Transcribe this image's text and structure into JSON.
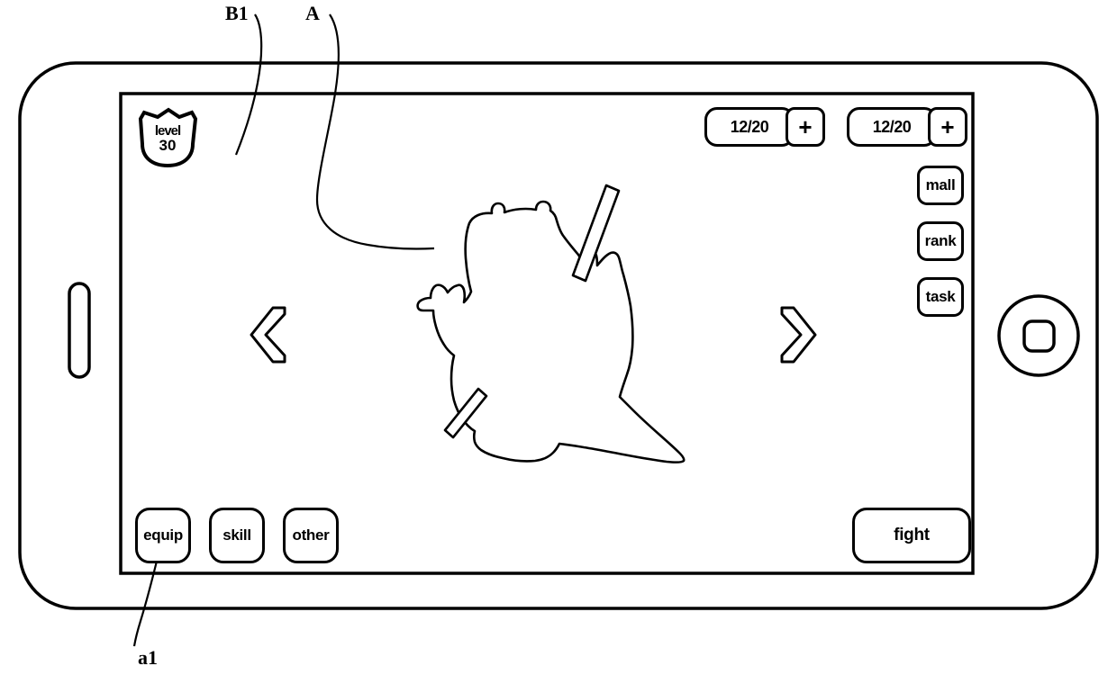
{
  "figure": {
    "reference_labels": [
      {
        "id": "B1",
        "text": "B1"
      },
      {
        "id": "A",
        "text": "A"
      },
      {
        "id": "a1",
        "text": "a1"
      }
    ]
  },
  "device": {
    "home_button": "home-button",
    "side_button": "side-button"
  },
  "game_ui": {
    "level_badge": {
      "word": "level",
      "value": "30"
    },
    "counters": [
      {
        "name": "resource-counter-1",
        "value": "12/20",
        "plus": "+"
      },
      {
        "name": "resource-counter-2",
        "value": "12/20",
        "plus": "+"
      }
    ],
    "side_menu": [
      {
        "name": "mall",
        "label": "mall"
      },
      {
        "name": "rank",
        "label": "rank"
      },
      {
        "name": "task",
        "label": "task"
      }
    ],
    "nav_arrows": {
      "previous": "chevron-left-icon",
      "next": "chevron-right-icon"
    },
    "bottom_menu": [
      {
        "name": "equip",
        "label": "equip"
      },
      {
        "name": "skill",
        "label": "skill"
      },
      {
        "name": "other",
        "label": "other"
      }
    ],
    "fight_button": {
      "label": "fight"
    },
    "character": "character-silhouette"
  },
  "colors": {
    "stroke": "#000000",
    "background": "#ffffff"
  }
}
